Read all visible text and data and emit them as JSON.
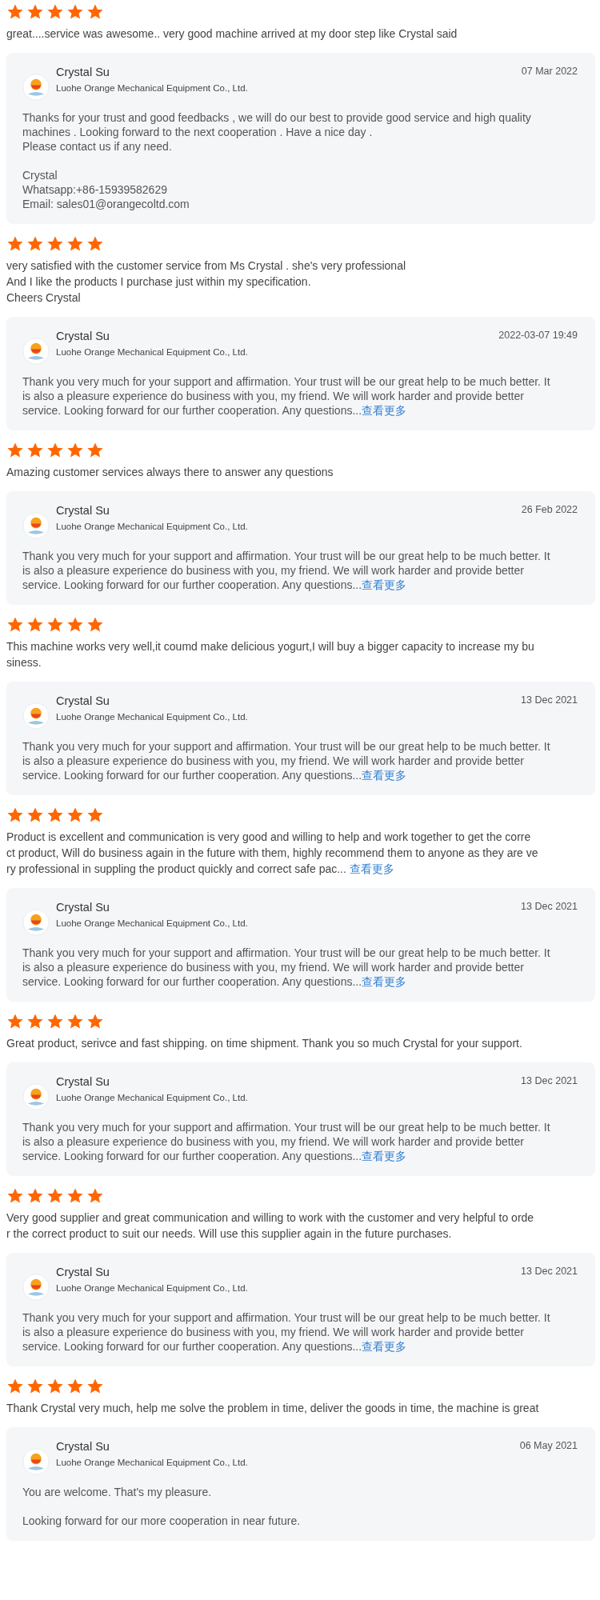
{
  "reviews": [
    {
      "stars": 5,
      "lines": [
        "great....service was awesome.. very good machine arrived at my door step like Crystal said"
      ],
      "reply": {
        "name": "Crystal Su",
        "company": "Luohe Orange Mechanical Equipment Co., Ltd.",
        "date": "07 Mar 2022",
        "paragraphs": [
          "Thanks for your trust and good feedbacks , we will do our best  to provide good service and high quality machines . Looking forward to the next cooperation . Have a nice day .\nPlease contact us if any need.",
          "Crystal\nWhatsapp:+86-15939582629\nEmail: sales01@orangecoltd.com"
        ]
      }
    },
    {
      "stars": 5,
      "lines": [
        "very satisfied with the customer service from Ms Crystal . she's very professional",
        "And I like the products I purchase just within my specification.",
        "Cheers Crystal"
      ],
      "reply": {
        "name": "Crystal Su",
        "company": "Luohe Orange Mechanical Equipment Co., Ltd.",
        "date": "2022-03-07 19:49",
        "paragraphs": [
          "Thank you very much for your support and affirmation. Your trust will be our great help to be much better. It is also a pleasure experience do business with you, my friend. We will work harder and provide better service. Looking forward for our further cooperation.  Any questions..."
        ],
        "more": "查看更多"
      }
    },
    {
      "stars": 5,
      "lines": [
        "Amazing customer services always there to answer any questions"
      ],
      "reply": {
        "name": "Crystal Su",
        "company": "Luohe Orange Mechanical Equipment Co., Ltd.",
        "date": "26 Feb 2022",
        "paragraphs": [
          "Thank you very much for your support and affirmation. Your trust will be our great help to be much better. It is also a pleasure experience do business with you, my friend. We will work harder and provide better service. Looking forward for our further cooperation.  Any questions..."
        ],
        "more": "查看更多"
      }
    },
    {
      "stars": 5,
      "lines": [
        "This machine works very well,it coumd make delicious yogurt,I will buy a bigger capacity to increase my bu",
        "siness."
      ],
      "reply": {
        "name": "Crystal Su",
        "company": "Luohe Orange Mechanical Equipment Co., Ltd.",
        "date": "13 Dec 2021",
        "paragraphs": [
          "Thank you very much for your support and affirmation. Your trust will be our great help to be much better. It is also a pleasure experience do business with you, my friend. We will work harder and provide better service. Looking forward for our further cooperation.  Any questions..."
        ],
        "more": "查看更多"
      }
    },
    {
      "stars": 5,
      "lines": [
        "Product is excellent and communication is very good and willing to help and work together to get the corre",
        "ct product, Will do business again in the future with them, highly recommend them to anyone as they are ve",
        "ry professional in suppling the product quickly and correct safe pac... "
      ],
      "more": "查看更多",
      "reply": {
        "name": "Crystal Su",
        "company": "Luohe Orange Mechanical Equipment Co., Ltd.",
        "date": "13 Dec 2021",
        "paragraphs": [
          "Thank you very much for your support and affirmation. Your trust will be our great help to be much better. It is also a pleasure experience do business with you, my friend. We will work harder and provide better service. Looking forward for our further cooperation.  Any questions..."
        ],
        "more": "查看更多"
      }
    },
    {
      "stars": 5,
      "lines": [
        "Great product, serivce and fast shipping. on time shipment. Thank you so much Crystal for your support."
      ],
      "reply": {
        "name": "Crystal Su",
        "company": "Luohe Orange Mechanical Equipment Co., Ltd.",
        "date": "13 Dec 2021",
        "paragraphs": [
          "Thank you very much for your support and affirmation. Your trust will be our great help to be much better. It is also a pleasure experience do business with you, my friend. We will work harder and provide better service. Looking forward for our further cooperation.  Any questions..."
        ],
        "more": "查看更多"
      }
    },
    {
      "stars": 5,
      "lines": [
        "Very good supplier and great communication and willing to work with the customer and very helpful to orde",
        "r the correct product to suit our needs. Will use this supplier again in the future purchases."
      ],
      "reply": {
        "name": "Crystal Su",
        "company": "Luohe Orange Mechanical Equipment Co., Ltd.",
        "date": "13 Dec 2021",
        "paragraphs": [
          "Thank you very much for your support and affirmation. Your trust will be our great help to be much better. It is also a pleasure experience do business with you, my friend. We will work harder and provide better service. Looking forward for our further cooperation.  Any questions..."
        ],
        "more": "查看更多"
      }
    },
    {
      "stars": 5,
      "lines": [
        "Thank Crystal very much, help me solve the problem in time, deliver the goods in time, the machine is great"
      ],
      "reply": {
        "name": "Crystal Su",
        "company": "Luohe Orange Mechanical Equipment Co., Ltd.",
        "date": "06 May 2021",
        "paragraphs": [
          "You are welcome. That's my pleasure.",
          "Looking forward for our more cooperation in near future."
        ]
      }
    }
  ]
}
